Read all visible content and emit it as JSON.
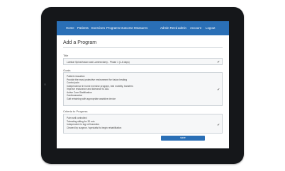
{
  "nav": {
    "home": "Home",
    "patients": "Patients",
    "exercises": "Exercises",
    "programs": "Programs",
    "outcome_measures": "Outcome Measures",
    "user": "Admin Reed",
    "admin": "admin",
    "account": "Account",
    "logout": "Logout"
  },
  "page_title": "Add a Program",
  "title_field": {
    "label": "Title",
    "value": "Lumbar Spinal fusion and Laminectomy - Phase 1 (1-6 days)"
  },
  "goals_field": {
    "label": "Goals",
    "lines": [
      "Patient education",
      "Provide the most protective environment for fusion healing",
      "Control pain",
      "Independence in home exercise program, bed mobility, transfers",
      "Improve endurance and tolerance to ADL",
      "Active Core Stabilization",
      "Cardiovascular",
      "Gait retraining with appropriate assistive device"
    ]
  },
  "criteria_field": {
    "label": "Criteria to Progress",
    "lines": [
      "Pain well controlled",
      "Tolerating sitting for 30 min",
      "Independent in log roll transfers",
      "Cleared by surgeon / specialist to begin rehabilitation"
    ]
  },
  "check_glyph": "✔",
  "save_label": "save",
  "colors": {
    "navbar": "#2a6fb6",
    "button": "#2a6fb6",
    "bezel": "#15171a"
  }
}
